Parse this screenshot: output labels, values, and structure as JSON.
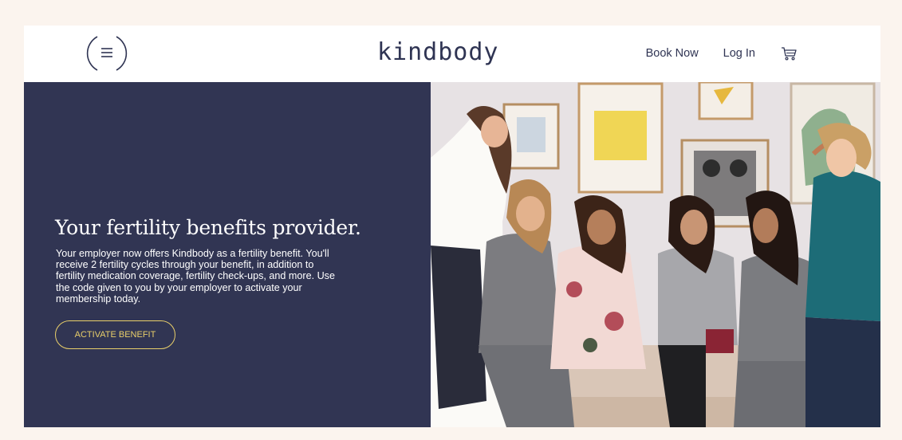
{
  "header": {
    "logo_text": "kindbody",
    "nav": {
      "book_now": "Book Now",
      "log_in": "Log In"
    },
    "icons": {
      "menu": "menu-icon",
      "cart": "cart-icon"
    }
  },
  "hero": {
    "title": "Your fertility benefits provider.",
    "description": "Your employer now offers Kindbody as a fertility benefit. You'll receive 2 fertility cycles through your benefit, in addition to fertility medication coverage, fertility check-ups, and more. Use the code given to you by your employer to activate your membership today.",
    "cta_label": "ACTIVATE BENEFIT"
  },
  "colors": {
    "page_bg": "#fbf4ee",
    "brand_navy": "#313553",
    "accent_yellow": "#e9cf6a",
    "text_dark": "#2f3453"
  }
}
